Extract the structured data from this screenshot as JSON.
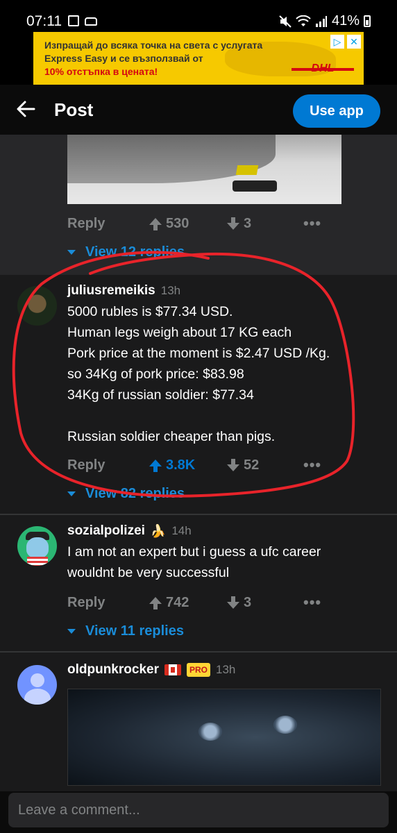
{
  "status_bar": {
    "time": "07:11",
    "battery": "41%",
    "icons_left": [
      "gallery-icon",
      "car-icon"
    ],
    "icons_right": [
      "mute-icon",
      "wifi-icon",
      "signal-icon",
      "battery-icon"
    ]
  },
  "ad": {
    "line1": "Изпращай до всяка точка на света с услугата",
    "line2": "Express Easy и се възползвай от",
    "line3": "10% отстъпка в цената!",
    "brand": "DHL",
    "badge_info": "▷",
    "badge_close": "✕"
  },
  "header": {
    "title": "Post",
    "use_app_label": "Use app"
  },
  "comments": [
    {
      "reply_label": "Reply",
      "upvotes": "530",
      "downvotes": "3",
      "more": "•••",
      "view_replies": "View 12 replies"
    },
    {
      "username": "juliusremeikis",
      "time": "13h",
      "body": "5000 rubles is $77.34 USD.\nHuman legs weigh about 17 KG each\nPork price at the moment is $2.47 USD /Kg.\nso 34Kg of pork price: $83.98\n34Kg of russian soldier: $77.34\n\nRussian soldier cheaper than pigs.",
      "reply_label": "Reply",
      "upvotes": "3.8K",
      "downvotes": "52",
      "more": "•••",
      "view_replies": "View 82 replies"
    },
    {
      "username": "sozialpolizei",
      "flair": "🍌",
      "time": "14h",
      "body": "I am not an expert but i guess a ufc career\nwouldnt be very successful",
      "reply_label": "Reply",
      "upvotes": "742",
      "downvotes": "3",
      "more": "•••",
      "view_replies": "View 11 replies"
    },
    {
      "username": "oldpunkrocker",
      "pro_badge": "PRO",
      "time": "13h"
    }
  ],
  "composer": {
    "placeholder": "Leave a comment..."
  },
  "colors": {
    "accent_blue": "#0079d3",
    "annotation_red": "#e8232a",
    "background": "#1a1a1b"
  }
}
